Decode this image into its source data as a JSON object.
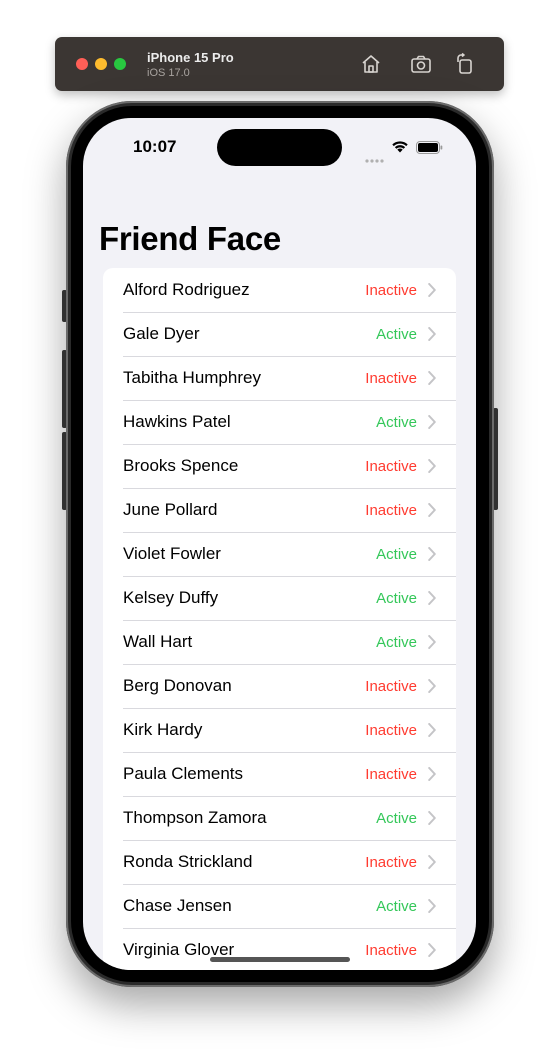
{
  "simulator": {
    "device_name": "iPhone 15 Pro",
    "os_version": "iOS 17.0"
  },
  "status_bar": {
    "time": "10:07"
  },
  "nav": {
    "title": "Friend Face"
  },
  "friends": [
    {
      "name": "Alford Rodriguez",
      "status": "Inactive"
    },
    {
      "name": "Gale Dyer",
      "status": "Active"
    },
    {
      "name": "Tabitha Humphrey",
      "status": "Inactive"
    },
    {
      "name": "Hawkins Patel",
      "status": "Active"
    },
    {
      "name": "Brooks Spence",
      "status": "Inactive"
    },
    {
      "name": "June Pollard",
      "status": "Inactive"
    },
    {
      "name": "Violet Fowler",
      "status": "Active"
    },
    {
      "name": "Kelsey Duffy",
      "status": "Active"
    },
    {
      "name": "Wall Hart",
      "status": "Active"
    },
    {
      "name": "Berg Donovan",
      "status": "Inactive"
    },
    {
      "name": "Kirk Hardy",
      "status": "Inactive"
    },
    {
      "name": "Paula Clements",
      "status": "Inactive"
    },
    {
      "name": "Thompson Zamora",
      "status": "Active"
    },
    {
      "name": "Ronda Strickland",
      "status": "Inactive"
    },
    {
      "name": "Chase Jensen",
      "status": "Active"
    },
    {
      "name": "Virginia Glover",
      "status": "Inactive"
    }
  ],
  "colors": {
    "active": "#34c759",
    "inactive": "#ff3b30",
    "background": "#f2f2f7"
  }
}
